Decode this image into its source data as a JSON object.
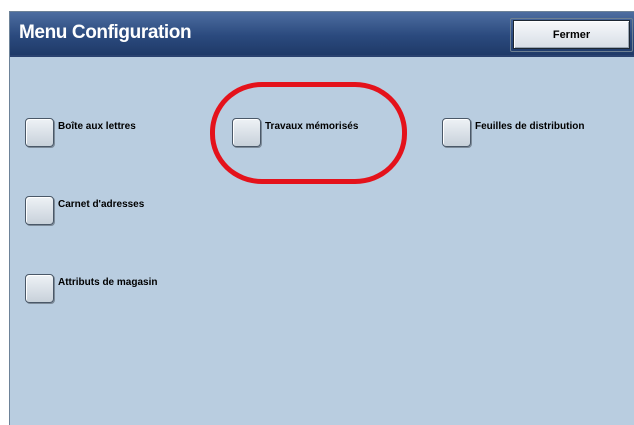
{
  "header": {
    "title": "Menu Configuration",
    "close_label": "Fermer"
  },
  "options": [
    {
      "label": "Boîte aux lettres"
    },
    {
      "label": "Travaux mémorisés"
    },
    {
      "label": "Feuilles de distribution"
    },
    {
      "label": "Carnet d'adresses"
    },
    {
      "label": "Attributs de magasin"
    }
  ],
  "highlight": {
    "color": "#e4121b",
    "target": "Travaux mémorisés"
  },
  "colors": {
    "panel_bg": "#b9cde0",
    "header_bg": "#2b4a7e",
    "title_text": "#ffffff"
  }
}
